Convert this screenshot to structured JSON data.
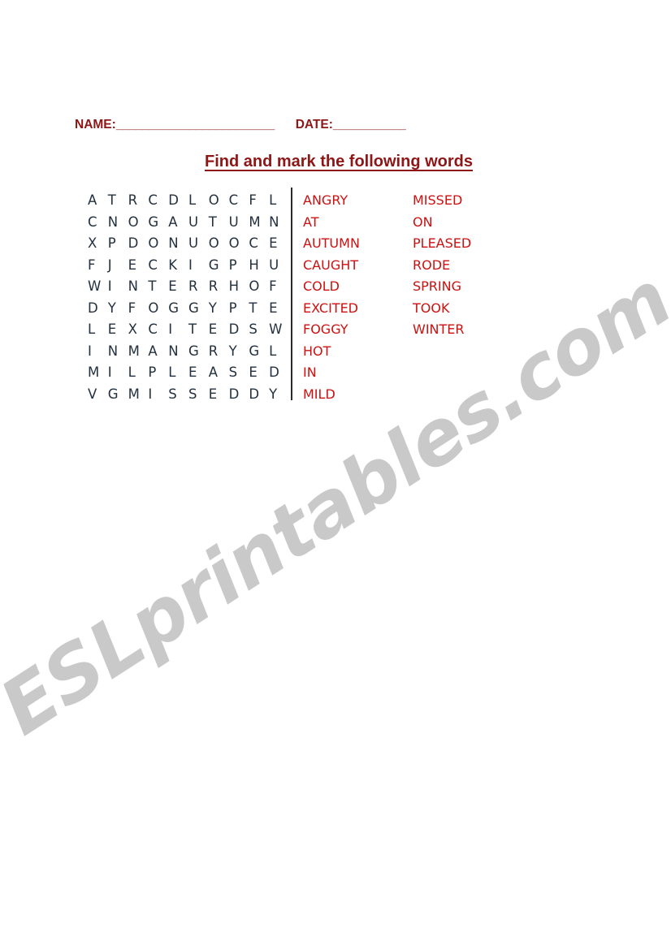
{
  "document": {
    "kind": "word-search-worksheet",
    "page_background": "#ffffff"
  },
  "header": {
    "name_label": "NAME:",
    "name_rule": "________________________",
    "date_label": "DATE:",
    "date_rule": "___________",
    "title": "Find and mark the following words",
    "heading_color": "#8d1616"
  },
  "grid": {
    "rows": 10,
    "columns": 10,
    "letter_color": "#23303f",
    "letters": [
      [
        "A",
        "T",
        "R",
        "C",
        "D",
        "L",
        "O",
        "C",
        "F",
        "L"
      ],
      [
        "C",
        "N",
        "O",
        "G",
        "A",
        "U",
        "T",
        "U",
        "M",
        "N"
      ],
      [
        "X",
        "P",
        "D",
        "O",
        "N",
        "U",
        "O",
        "O",
        "C",
        "E"
      ],
      [
        "F",
        "J",
        "E",
        "C",
        "K",
        "I",
        "G",
        "P",
        "H",
        "U"
      ],
      [
        "W",
        "I",
        "N",
        "T",
        "E",
        "R",
        "R",
        "H",
        "O",
        "F"
      ],
      [
        "D",
        "Y",
        "F",
        "O",
        "G",
        "G",
        "Y",
        "P",
        "T",
        "E"
      ],
      [
        "L",
        "E",
        "X",
        "C",
        "I",
        "T",
        "E",
        "D",
        "S",
        "W"
      ],
      [
        "I",
        "N",
        "M",
        "A",
        "N",
        "G",
        "R",
        "Y",
        "G",
        "L"
      ],
      [
        "M",
        "I",
        "L",
        "P",
        "L",
        "E",
        "A",
        "S",
        "E",
        "D"
      ],
      [
        "V",
        "G",
        "M",
        "I",
        "S",
        "S",
        "E",
        "D",
        "D",
        "Y"
      ]
    ]
  },
  "word_list": {
    "word_color": "#cc1111",
    "columns": [
      {
        "words": [
          "ANGRY",
          "AT",
          "AUTUMN",
          "CAUGHT",
          "COLD",
          "EXCITED",
          "FOGGY",
          "HOT",
          "IN",
          "MILD"
        ]
      },
      {
        "words": [
          "MISSED",
          "ON",
          "PLEASED",
          "RODE",
          "SPRING",
          "TOOK",
          "WINTER"
        ]
      }
    ]
  },
  "watermark": {
    "text": "ESLprintables.com",
    "color": "#c9c9c9"
  }
}
